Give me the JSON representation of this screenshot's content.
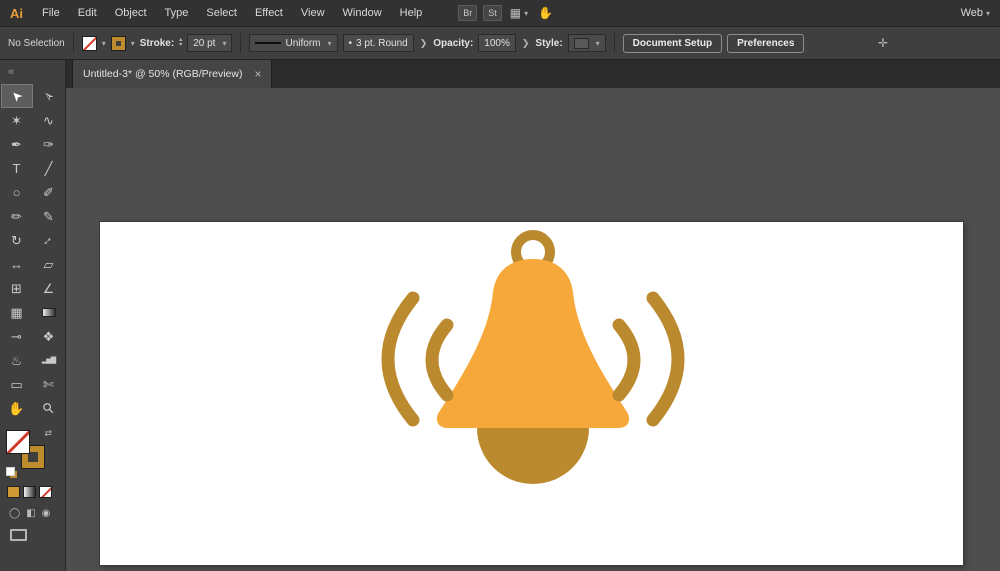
{
  "menubar": {
    "logo": "Ai",
    "menus": [
      "File",
      "Edit",
      "Object",
      "Type",
      "Select",
      "Effect",
      "View",
      "Window",
      "Help"
    ],
    "bridge_label": "Br",
    "stock_label": "St",
    "arrange_icon": "▦",
    "touch_icon": "✋",
    "workspace_label": "Web"
  },
  "ui": {
    "caret": "▾",
    "chevron": "❯",
    "collapse": "«",
    "swap": "⇄",
    "dot": "•",
    "step_up": "▴",
    "step_down": "▾",
    "close": "×"
  },
  "controlbar": {
    "selection_status": "No Selection",
    "stroke_label": "Stroke:",
    "stroke_value": "20 pt",
    "width_profile": "Uniform",
    "brush_name": "3 pt. Round",
    "opacity_label": "Opacity:",
    "opacity_value": "100%",
    "style_label": "Style:",
    "document_setup_label": "Document Setup",
    "preferences_label": "Preferences",
    "touch_workspace_icon": "✛",
    "fill_value": "none",
    "stroke_color": "#be8c2d"
  },
  "document_tab": {
    "title": "Untitled-3* @ 50% (RGB/Preview)"
  },
  "toolbar": {
    "tools": [
      {
        "name": "selection",
        "glyph": "➤",
        "active": true
      },
      {
        "name": "direct-selection",
        "glyph": "➢"
      },
      {
        "name": "magic-wand",
        "glyph": "✶"
      },
      {
        "name": "lasso",
        "glyph": "∿"
      },
      {
        "name": "pen",
        "glyph": "✒"
      },
      {
        "name": "curvature",
        "glyph": "✑"
      },
      {
        "name": "type",
        "glyph": "T"
      },
      {
        "name": "line-segment",
        "glyph": "╱"
      },
      {
        "name": "ellipse",
        "glyph": "○"
      },
      {
        "name": "paintbrush",
        "glyph": "✐"
      },
      {
        "name": "pencil",
        "glyph": "✏"
      },
      {
        "name": "shaper",
        "glyph": "✎"
      },
      {
        "name": "rotate",
        "glyph": "↻"
      },
      {
        "name": "scale",
        "glyph": "↕"
      },
      {
        "name": "width",
        "glyph": "↔"
      },
      {
        "name": "free-transform",
        "glyph": "▱"
      },
      {
        "name": "shape-builder",
        "glyph": "⊞"
      },
      {
        "name": "perspective-grid",
        "glyph": "∠"
      },
      {
        "name": "mesh",
        "glyph": "▦"
      },
      {
        "name": "gradient",
        "glyph": ""
      },
      {
        "name": "eyedropper",
        "glyph": "⊸"
      },
      {
        "name": "blend",
        "glyph": "❖"
      },
      {
        "name": "symbol-sprayer",
        "glyph": "♨"
      },
      {
        "name": "column-graph",
        "glyph": "▂▅▇"
      },
      {
        "name": "artboard",
        "glyph": "▭"
      },
      {
        "name": "slice",
        "glyph": "✄"
      },
      {
        "name": "hand",
        "glyph": "✋"
      },
      {
        "name": "zoom",
        "glyph": "⚲"
      }
    ],
    "draw_modes": [
      "◯",
      "◧",
      "◉"
    ]
  },
  "artwork": {
    "description": "bell icon with sound waves",
    "body_color": "#F7A83B",
    "accent_color": "#BC8A2E"
  }
}
